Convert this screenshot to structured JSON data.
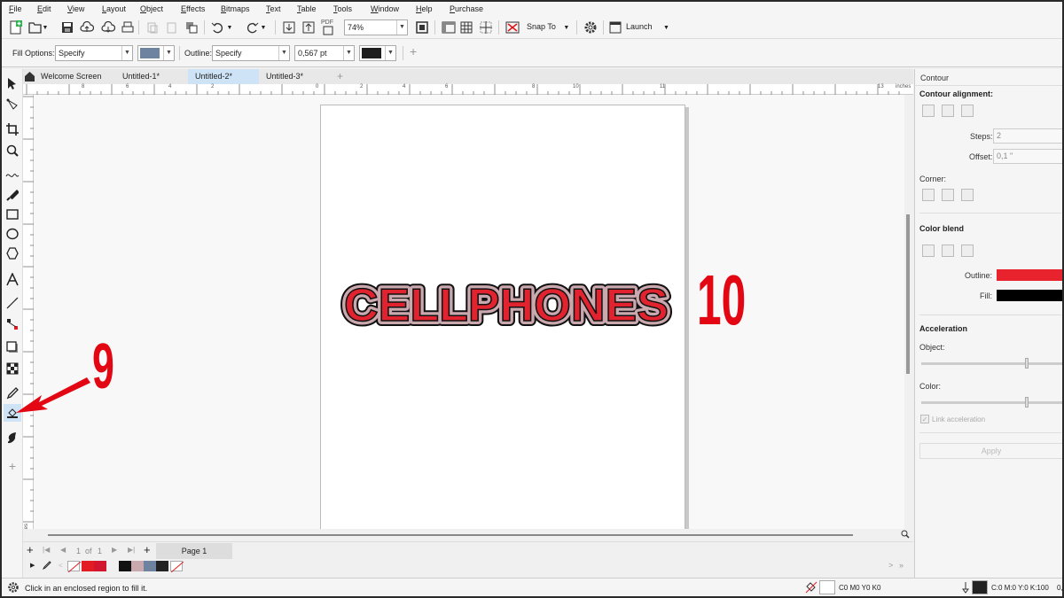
{
  "menu": [
    "File",
    "Edit",
    "View",
    "Layout",
    "Object",
    "Effects",
    "Bitmaps",
    "Text",
    "Table",
    "Tools",
    "Window",
    "Help",
    "Purchase"
  ],
  "toolbar": {
    "pdf_label": "PDF",
    "zoom": "74%",
    "snap_to": "Snap To",
    "launch": "Launch"
  },
  "propbar": {
    "fill_options_label": "Fill Options:",
    "fill_options_value": "Specify",
    "fill_color": "#6e83a0",
    "outline_label": "Outline:",
    "outline_value": "Specify",
    "outline_width": "0,567 pt",
    "outline_color": "#1e1e1e"
  },
  "tabs": [
    "Welcome Screen",
    "Untitled-1*",
    "Untitled-2*",
    "Untitled-3*"
  ],
  "ruler": {
    "h_labels": [
      "8",
      "6",
      "4",
      "2",
      "0",
      "2",
      "4",
      "6",
      "8",
      "10",
      "11",
      "13",
      "inches"
    ],
    "v_units": "inches"
  },
  "artwork": {
    "text": "CELLPHONES",
    "fill_color": "#c9a8ae",
    "letter_color": "#e0232e",
    "outline_color": "#111111"
  },
  "annotations": {
    "left_number": "9",
    "right_number": "10"
  },
  "pagenav": {
    "page_pos": "1",
    "of_label": "of",
    "page_total": "1",
    "page_tab": "Page 1"
  },
  "palette": [
    "#e31b23",
    "#d2162f",
    "#111111",
    "#c9a8ae",
    "#6e83a0",
    "#222222"
  ],
  "status": {
    "hint": "Click in an enclosed region to fill it.",
    "fill_cmyk": "C0 M0 Y0 K0",
    "outline_cmyk": "C:0 M:0 Y:0 K:100",
    "outline_width_partial": "0,"
  },
  "docker": {
    "title": "Contour",
    "contour_alignment": "Contour alignment:",
    "steps_label": "Steps:",
    "steps_value": "2",
    "offset_label": "Offset:",
    "offset_value": "0,1 \"",
    "corner_label": "Corner:",
    "color_blend": "Color blend",
    "outline_label": "Outline:",
    "outline_color": "#e8232e",
    "fill_label": "Fill:",
    "fill_color": "#000000",
    "acceleration": "Acceleration",
    "object_label": "Object:",
    "color_label": "Color:",
    "link_acceleration": "Link acceleration",
    "apply": "Apply"
  }
}
